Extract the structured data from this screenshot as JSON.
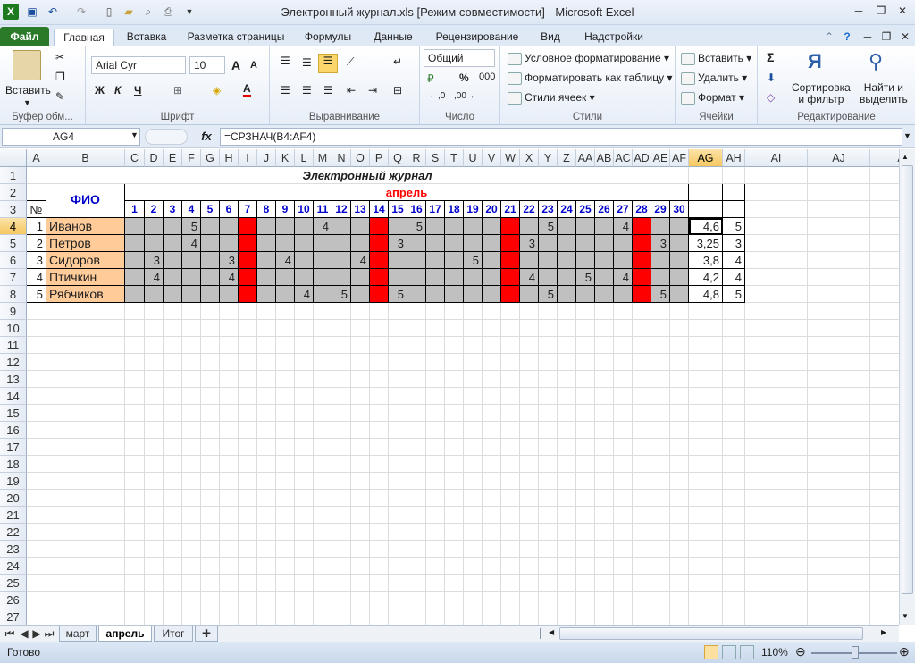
{
  "window": {
    "title": "Электронный журнал.xls  [Режим совместимости]  -  Microsoft Excel",
    "minimize": "─",
    "restore": "❐",
    "close": "✕"
  },
  "tabs": {
    "file": "Файл",
    "items": [
      "Главная",
      "Вставка",
      "Разметка страницы",
      "Формулы",
      "Данные",
      "Рецензирование",
      "Вид",
      "Надстройки"
    ]
  },
  "ribbon": {
    "clipboard": {
      "paste": "Вставить",
      "label": "Буфер обм..."
    },
    "font": {
      "name": "Arial Cyr",
      "size": "10",
      "bold": "Ж",
      "italic": "К",
      "underline": "Ч",
      "grow": "A",
      "shrink": "A",
      "color": "A",
      "label": "Шрифт"
    },
    "align": {
      "label": "Выравнивание"
    },
    "number": {
      "format": "Общий",
      "percent": "%",
      "thousands": "000",
      "label": "Число"
    },
    "styles": {
      "conditional": "Условное форматирование",
      "as_table": "Форматировать как таблицу",
      "cell_styles": "Стили ячеек",
      "label": "Стили"
    },
    "cells": {
      "insert": "Вставить",
      "delete": "Удалить",
      "format": "Формат",
      "label": "Ячейки"
    },
    "editing": {
      "sigma": "Σ",
      "sort": "Сортировка\nи фильтр",
      "find": "Найти и\nвыделить",
      "label": "Редактирование"
    }
  },
  "formula_bar": {
    "name_box": "AG4",
    "fx": "fx",
    "formula": "=СРЗНАЧ(B4:AF4)"
  },
  "columns": [
    "A",
    "B",
    "C",
    "D",
    "E",
    "F",
    "G",
    "H",
    "I",
    "J",
    "K",
    "L",
    "M",
    "N",
    "O",
    "P",
    "Q",
    "R",
    "S",
    "T",
    "U",
    "V",
    "W",
    "X",
    "Y",
    "Z",
    "AA",
    "AB",
    "AC",
    "AD",
    "AE",
    "AF",
    "AG",
    "AH",
    "AI",
    "AJ",
    "A"
  ],
  "rows": [
    "1",
    "2",
    "3",
    "4",
    "5",
    "6",
    "7",
    "8",
    "9",
    "10",
    "11",
    "12",
    "13",
    "14",
    "15",
    "16",
    "17",
    "18",
    "19",
    "20",
    "21",
    "22",
    "23",
    "24",
    "25",
    "26",
    "27"
  ],
  "sheet": {
    "title": "Электронный журнал",
    "fio": "ФИО",
    "month": "апрель",
    "num_header": "№",
    "days": [
      "1",
      "2",
      "3",
      "4",
      "5",
      "6",
      "7",
      "8",
      "9",
      "10",
      "11",
      "12",
      "13",
      "14",
      "15",
      "16",
      "17",
      "18",
      "19",
      "20",
      "21",
      "22",
      "23",
      "24",
      "25",
      "26",
      "27",
      "28",
      "29",
      "30"
    ],
    "red_days": [
      7,
      14,
      21,
      28
    ],
    "students": [
      {
        "n": "1",
        "name": "Иванов",
        "marks": {
          "4": "5",
          "11": "4",
          "16": "5",
          "23": "5",
          "27": "4"
        },
        "avg": "4,6",
        "final": "5"
      },
      {
        "n": "2",
        "name": "Петров",
        "marks": {
          "4": "4",
          "15": "3",
          "22": "3",
          "29": "3"
        },
        "avg": "3,25",
        "final": "3"
      },
      {
        "n": "3",
        "name": "Сидоров",
        "marks": {
          "2": "3",
          "6": "3",
          "9": "4",
          "13": "4",
          "19": "5"
        },
        "avg": "3,8",
        "final": "4"
      },
      {
        "n": "4",
        "name": "Птичкин",
        "marks": {
          "2": "4",
          "6": "4",
          "22": "4",
          "25": "5",
          "27": "4"
        },
        "avg": "4,2",
        "final": "4"
      },
      {
        "n": "5",
        "name": "Рябчиков",
        "marks": {
          "10": "4",
          "12": "5",
          "15": "5",
          "23": "5",
          "29": "5"
        },
        "avg": "4,8",
        "final": "5"
      }
    ]
  },
  "sheet_tabs": [
    "март",
    "апрель",
    "Итог"
  ],
  "status": {
    "ready": "Готово",
    "zoom": "110%"
  },
  "colors": {
    "red": "#ff0000",
    "gray": "#c0c0c0",
    "peach": "#ffcc99",
    "blue": "#0000cc",
    "selected": "#f6c860"
  }
}
